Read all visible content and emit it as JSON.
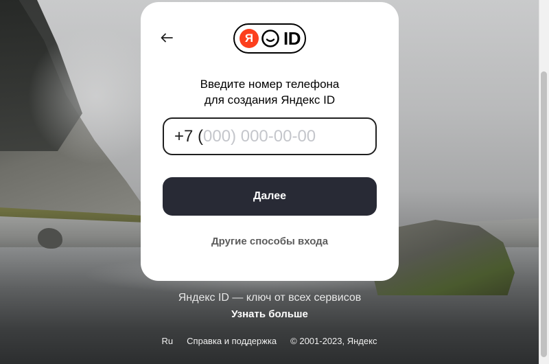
{
  "logo": {
    "ya_letter": "Я",
    "id_text": "ID",
    "brand_color": "#fc3f1d"
  },
  "card": {
    "heading_line1": "Введите номер телефона",
    "heading_line2": "для создания Яндекс ID",
    "phone": {
      "prefix": "+7 (",
      "placeholder": "000) 000-00-00"
    },
    "next_button_label": "Далее",
    "other_ways_label": "Другие способы входа",
    "button_color": "#282a35"
  },
  "below": {
    "tagline": "Яндекс ID — ключ от всех сервисов",
    "learn_more_label": "Узнать больше"
  },
  "footer": {
    "language": "Ru",
    "help": "Справка и поддержка",
    "copyright": "© 2001-2023, Яндекс"
  },
  "icons": {
    "back": "arrow-left-icon",
    "face": "smile-face-icon"
  }
}
